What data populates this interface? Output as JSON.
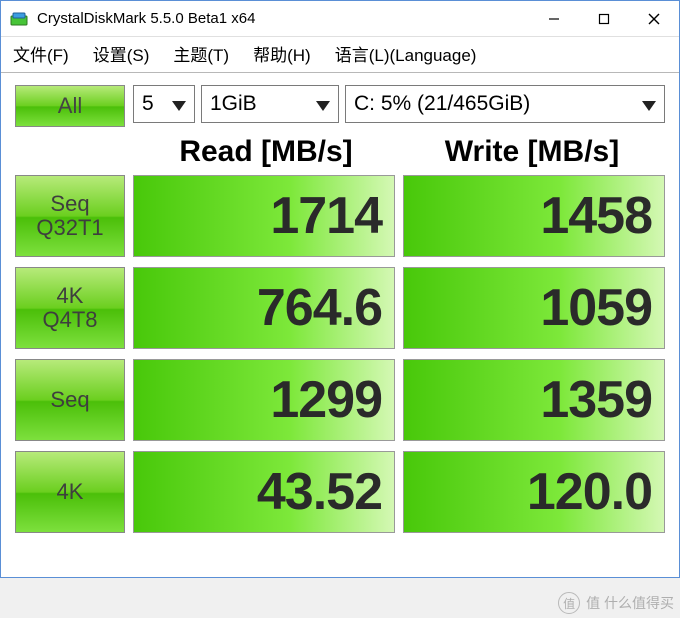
{
  "window": {
    "title": "CrystalDiskMark 5.5.0 Beta1 x64"
  },
  "menu": {
    "file": "文件(F)",
    "settings": "设置(S)",
    "theme": "主题(T)",
    "help": "帮助(H)",
    "language": "语言(L)(Language)"
  },
  "controls": {
    "all_label": "All",
    "count": "5",
    "size": "1GiB",
    "drive": "C: 5% (21/465GiB)"
  },
  "headers": {
    "read": "Read [MB/s]",
    "write": "Write [MB/s]"
  },
  "tests": [
    {
      "label": "Seq\nQ32T1",
      "read": "1714",
      "write": "1458"
    },
    {
      "label": "4K\nQ4T8",
      "read": "764.6",
      "write": "1059"
    },
    {
      "label": "Seq",
      "read": "1299",
      "write": "1359"
    },
    {
      "label": "4K",
      "read": "43.52",
      "write": "120.0"
    }
  ],
  "watermark": {
    "text": "值  什么值得买"
  },
  "chart_data": {
    "type": "table",
    "title": "CrystalDiskMark 5.5.0 Beta1 x64",
    "drive": "C: 5% (21/465GiB)",
    "test_size": "1GiB",
    "runs": 5,
    "columns": [
      "Test",
      "Read [MB/s]",
      "Write [MB/s]"
    ],
    "rows": [
      [
        "Seq Q32T1",
        1714,
        1458
      ],
      [
        "4K Q4T8",
        764.6,
        1059
      ],
      [
        "Seq",
        1299,
        1359
      ],
      [
        "4K",
        43.52,
        120.0
      ]
    ]
  }
}
